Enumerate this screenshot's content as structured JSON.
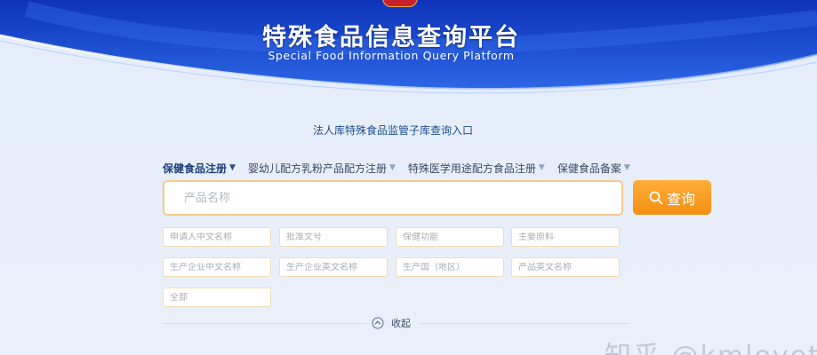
{
  "header": {
    "title": "特殊食品信息查询平台",
    "subtitle": "Special Food Information Query Platform"
  },
  "entry_link": "法人库特殊食品监管子库查询入口",
  "tabs": [
    {
      "label": "保健食品注册",
      "active": true
    },
    {
      "label": "婴幼儿配方乳粉产品配方注册",
      "active": false
    },
    {
      "label": "特殊医学用途配方食品注册",
      "active": false
    },
    {
      "label": "保健食品备案",
      "active": false
    }
  ],
  "search": {
    "placeholder": "产品名称",
    "button_label": "查询"
  },
  "filters": [
    {
      "placeholder": "申请人中文名称"
    },
    {
      "placeholder": "批准文号"
    },
    {
      "placeholder": "保健功能"
    },
    {
      "placeholder": "主要原料"
    },
    {
      "placeholder": "生产企业中文名称"
    },
    {
      "placeholder": "生产企业英文名称"
    },
    {
      "placeholder": "生产国（地区）"
    },
    {
      "placeholder": "产品英文名称"
    },
    {
      "placeholder": "全部"
    }
  ],
  "collapse_label": "收起",
  "watermark": "知乎 @kmloveturtle",
  "colors": {
    "banner_blue": "#1f4fd0",
    "accent_orange": "#f7941d",
    "field_border": "#f1dcb4",
    "link_blue": "#1e4e8e"
  }
}
